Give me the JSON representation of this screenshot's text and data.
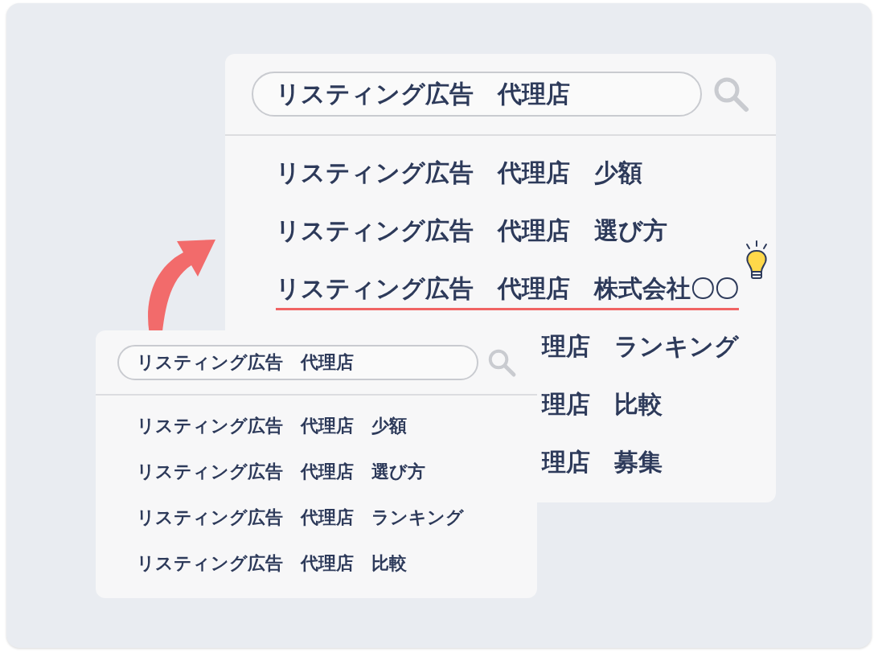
{
  "panels": [
    {
      "query": "リスティング広告　代理店",
      "suggestions": [
        {
          "text": "リスティング広告　代理店　少額",
          "highlighted": false,
          "covered": false
        },
        {
          "text": "リスティング広告　代理店　選び方",
          "highlighted": false,
          "covered": false
        },
        {
          "text": "リスティング広告　代理店　株式会社〇〇",
          "highlighted": true,
          "covered": false
        },
        {
          "text": "理店　ランキング",
          "highlighted": false,
          "covered": true
        },
        {
          "text": "理店　比較",
          "highlighted": false,
          "covered": true
        },
        {
          "text": "理店　募集",
          "highlighted": false,
          "covered": true
        }
      ]
    },
    {
      "query": "リスティング広告　代理店",
      "suggestions": [
        {
          "text": "リスティング広告　代理店　少額",
          "highlighted": false
        },
        {
          "text": "リスティング広告　代理店　選び方",
          "highlighted": false
        },
        {
          "text": "リスティング広告　代理店　ランキング",
          "highlighted": false
        },
        {
          "text": "リスティング広告　代理店　比較",
          "highlighted": false
        }
      ]
    }
  ]
}
